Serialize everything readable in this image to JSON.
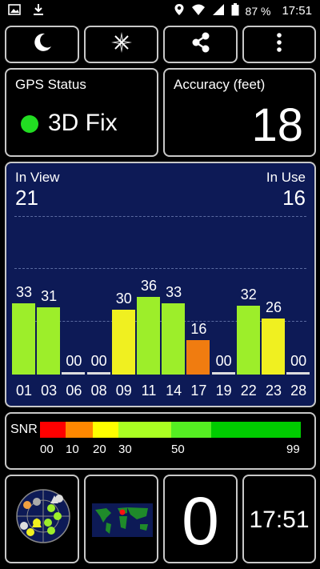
{
  "status_bar": {
    "battery": "87 %",
    "time": "17:51",
    "icons": [
      "image-icon",
      "download-icon",
      "location-icon",
      "wifi-icon",
      "signal-icon",
      "battery-icon"
    ]
  },
  "toolbar": {
    "buttons": [
      "night-mode-icon",
      "compass-icon",
      "share-icon",
      "more-vert-icon"
    ]
  },
  "gps_status": {
    "label": "GPS Status",
    "value": "3D Fix",
    "indicator_color": "#22dd22"
  },
  "accuracy": {
    "label": "Accuracy (feet)",
    "value": "18"
  },
  "satellites": {
    "in_view_label": "In View",
    "in_view": "21",
    "in_use_label": "In Use",
    "in_use": "16"
  },
  "chart_data": {
    "type": "bar",
    "categories": [
      "01",
      "03",
      "06",
      "08",
      "09",
      "11",
      "14",
      "17",
      "19",
      "22",
      "23",
      "28"
    ],
    "values": [
      33,
      31,
      0,
      0,
      30,
      36,
      33,
      16,
      0,
      32,
      26,
      0
    ],
    "value_labels": [
      "33",
      "31",
      "00",
      "00",
      "30",
      "36",
      "33",
      "16",
      "00",
      "32",
      "26",
      "00"
    ],
    "colors": [
      "#9dee2a",
      "#9dee2a",
      "#dddddd",
      "#dddddd",
      "#f0f020",
      "#9dee2a",
      "#9dee2a",
      "#f07c10",
      "#dddddd",
      "#9dee2a",
      "#f0f020",
      "#dddddd"
    ],
    "ylim": [
      0,
      60
    ]
  },
  "snr": {
    "label": "SNR",
    "ticks": [
      "00",
      "10",
      "20",
      "30",
      "50",
      "99"
    ],
    "segment_colors": [
      "#ff0000",
      "#ff8800",
      "#ffff00",
      "#aaff22",
      "#55ee22",
      "#00cc00"
    ]
  },
  "bottom": {
    "satellite_count": "0",
    "time": "17:51",
    "radar_icon": "sky-plot-icon",
    "map_icon": "world-map-icon"
  }
}
